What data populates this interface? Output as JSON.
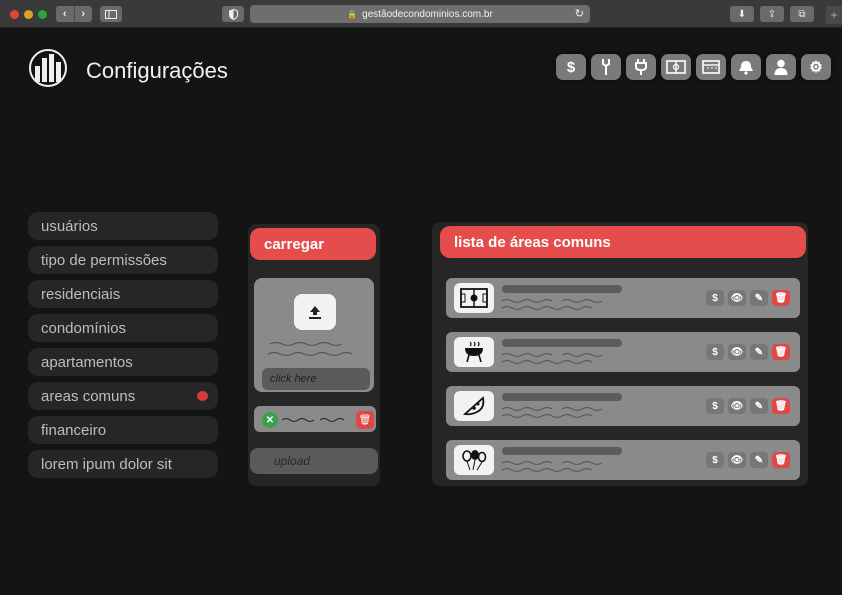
{
  "browser": {
    "url": "gestãodecondominios.com.br",
    "back_label": "‹",
    "forward_label": "›",
    "new_tab_label": "+"
  },
  "header": {
    "title": "Configurações",
    "icons": [
      "dollar-icon",
      "tools-icon",
      "plug-icon",
      "field-icon",
      "calendar-icon",
      "bell-icon",
      "user-icon",
      "gear-icon"
    ]
  },
  "sidebar": {
    "items": [
      {
        "label": "usuários"
      },
      {
        "label": "tipo de permissões"
      },
      {
        "label": "residenciais"
      },
      {
        "label": "condomínios"
      },
      {
        "label": "apartamentos"
      },
      {
        "label": "areas comuns"
      },
      {
        "label": "financeiro"
      },
      {
        "label": "lorem ipum dolor sit"
      }
    ],
    "active_index": 5
  },
  "upload_panel": {
    "title": "carregar",
    "dropzone_hint": "click here",
    "upload_label": "upload"
  },
  "areas_panel": {
    "title": "lista de áreas comuns",
    "items": [
      {
        "icon": "soccer-field-icon"
      },
      {
        "icon": "barbecue-grill-icon"
      },
      {
        "icon": "pizza-icon"
      },
      {
        "icon": "party-balloons-icon"
      }
    ]
  },
  "colors": {
    "accent_red": "#e54c4c",
    "success_green": "#3aa14a",
    "background": "#141414"
  }
}
